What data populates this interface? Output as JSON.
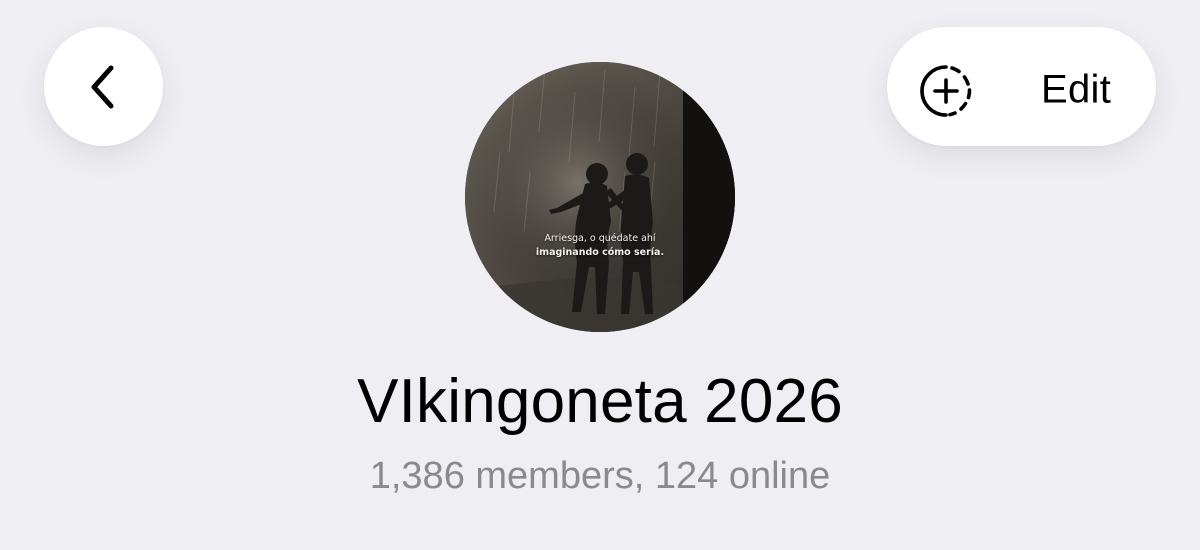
{
  "header": {
    "back_icon": "chevron-left-icon",
    "edit_label": "Edit",
    "add_story_icon": "add-story-icon"
  },
  "profile": {
    "avatar_caption_line1": "Arriesga, o quédate ahí",
    "avatar_caption_line2": "imaginando cómo sería.",
    "title": "VIkingoneta 2026",
    "subtitle": "1,386 members, 124 online"
  },
  "colors": {
    "background": "#efeef3",
    "button_background": "#ffffff",
    "subtitle_gray": "#8a8a8e"
  }
}
